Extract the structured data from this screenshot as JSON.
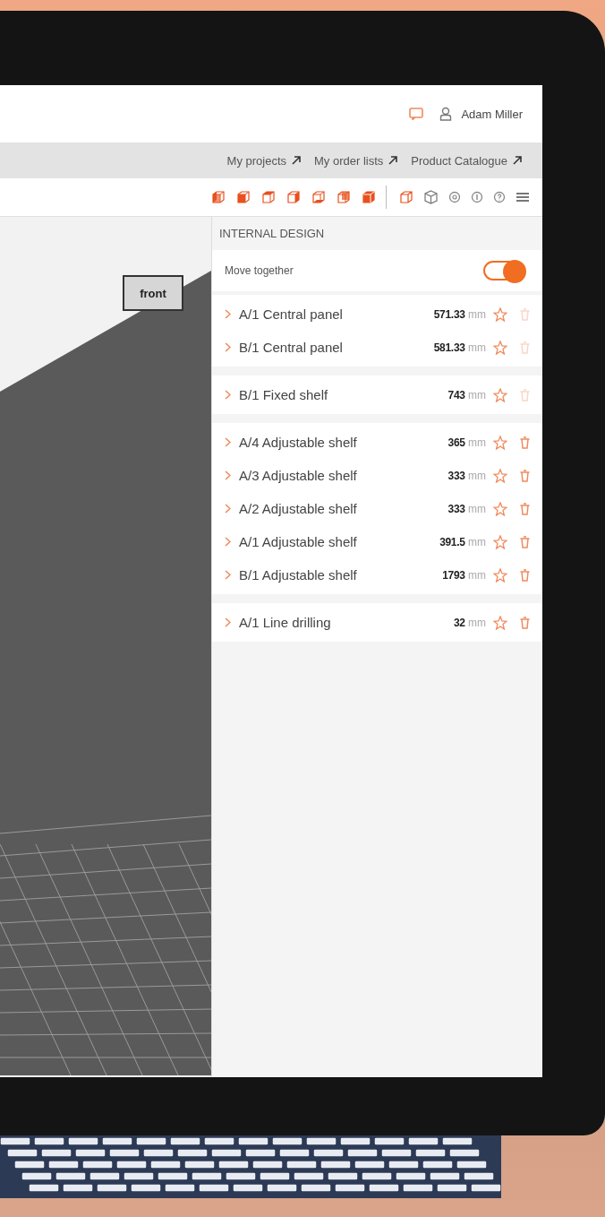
{
  "header": {
    "user_name": "Adam Miller"
  },
  "links": [
    "My projects",
    "My order lists",
    "Product Catalogue"
  ],
  "viewport": {
    "label": "front"
  },
  "panel": {
    "title": "INTERNAL DESIGN",
    "move_together": {
      "label": "Move together",
      "on": true
    },
    "groups": [
      {
        "items": [
          {
            "name": "A/1 Central panel",
            "value": "571.33",
            "unit": "mm",
            "deletable": false
          },
          {
            "name": "B/1 Central panel",
            "value": "581.33",
            "unit": "mm",
            "deletable": false
          }
        ]
      },
      {
        "items": [
          {
            "name": "B/1 Fixed shelf",
            "value": "743",
            "unit": "mm",
            "deletable": false
          }
        ]
      },
      {
        "items": [
          {
            "name": "A/4 Adjustable shelf",
            "value": "365",
            "unit": "mm",
            "deletable": true
          },
          {
            "name": "A/3 Adjustable shelf",
            "value": "333",
            "unit": "mm",
            "deletable": true
          },
          {
            "name": "A/2 Adjustable shelf",
            "value": "333",
            "unit": "mm",
            "deletable": true
          },
          {
            "name": "A/1 Adjustable shelf",
            "value": "391.5",
            "unit": "mm",
            "deletable": true
          },
          {
            "name": "B/1 Adjustable shelf",
            "value": "1793",
            "unit": "mm",
            "deletable": true
          }
        ]
      },
      {
        "items": [
          {
            "name": "A/1 Line drilling",
            "value": "32",
            "unit": "mm",
            "deletable": true
          }
        ]
      }
    ]
  }
}
